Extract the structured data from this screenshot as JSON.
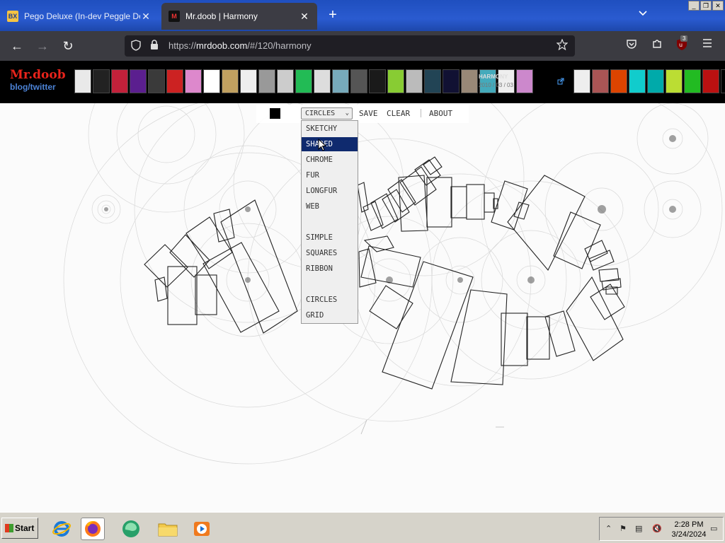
{
  "browser": {
    "tabs": [
      {
        "label": "Pego Deluxe (In-dev Peggle Delux",
        "favicon": "BX",
        "active": false
      },
      {
        "label": "Mr.doob | Harmony",
        "favicon": "M",
        "active": true
      }
    ],
    "new_tab_icon": "+",
    "tab_list_icon": "chevron-down-icon",
    "url_prefix": "https://",
    "url_host": "mrdoob.com",
    "url_path": "/#/120/harmony",
    "extension_badge": "3"
  },
  "site": {
    "logo_title": "Mr.doob",
    "logo_sub": "blog/twitter",
    "project_title": "HARMONY",
    "project_date": "2010 / 03 / 03",
    "thumb_colors_left": [
      "#e9e9e9",
      "#222",
      "#c2213a",
      "#5b1f8f",
      "#3a3a3a",
      "#c22",
      "#d8c",
      "#fff",
      "#c0a060",
      "#eee",
      "#999",
      "#ccc",
      "#2b5",
      "#ddd",
      "#7ab",
      "#555",
      "#1a1a1a",
      "#8c3",
      "#bbb",
      "#245",
      "#113",
      "#987",
      "#4ab",
      "#eee",
      "#c8c"
    ],
    "thumb_colors_right": [
      "#eee",
      "#a55",
      "#d40",
      "#1cc",
      "#0aa",
      "#bd3",
      "#2b2",
      "#b11",
      "#000"
    ]
  },
  "toolbar": {
    "fg_color": "#000000",
    "bg_color": "#ffffff",
    "brush_selected": "CIRCLES",
    "save": "SAVE",
    "clear": "CLEAR",
    "about": "ABOUT"
  },
  "brush_menu": {
    "options": [
      "SKETCHY",
      "SHADED",
      "CHROME",
      "FUR",
      "LONGFUR",
      "WEB",
      "",
      "SIMPLE",
      "SQUARES",
      "RIBBON",
      "",
      "CIRCLES",
      "GRID"
    ],
    "highlighted": "SHADED"
  },
  "taskbar": {
    "start_label": "Start",
    "clock_time": "2:28 PM",
    "clock_date": "3/24/2024"
  }
}
